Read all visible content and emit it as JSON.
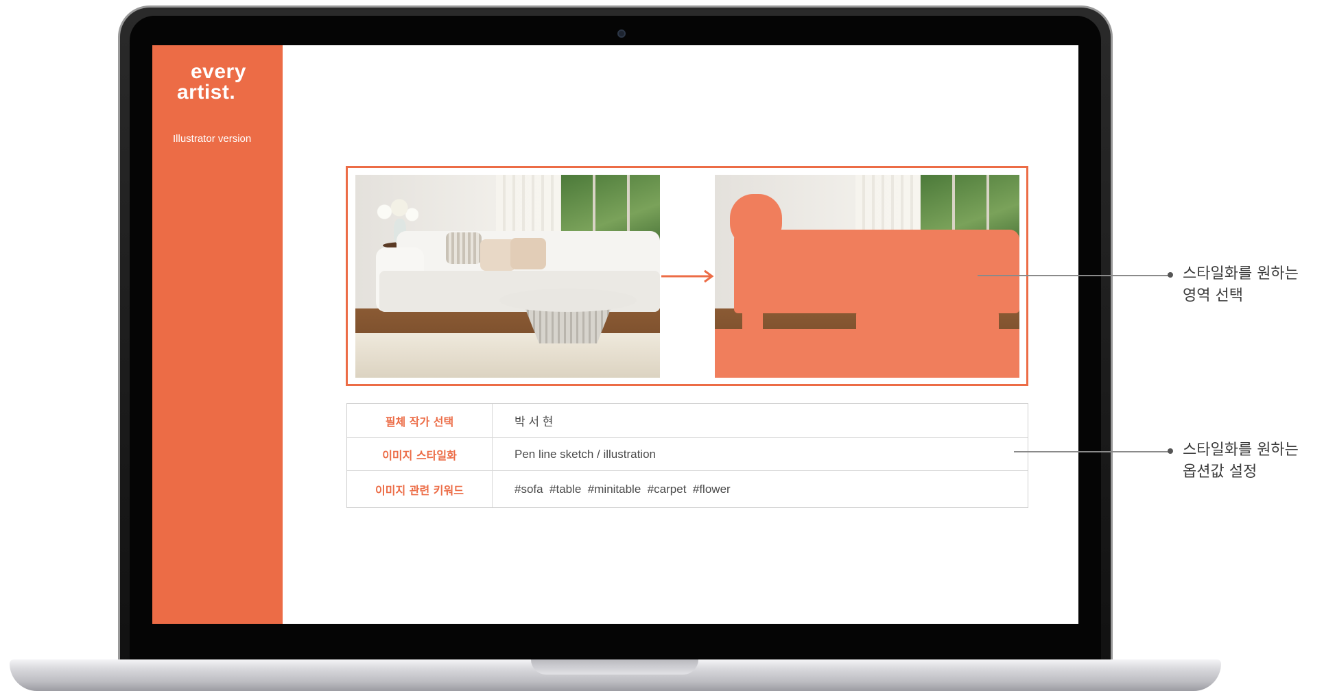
{
  "app": {
    "logo_line1": "every",
    "logo_line2": "artist.",
    "version_label": "Illustrator version"
  },
  "options": {
    "rows": [
      {
        "label": "필체 작가 선택",
        "value": "박 서 현"
      },
      {
        "label": "이미지 스타일화",
        "value": "Pen line sketch / illustration"
      },
      {
        "label": "이미지 관련 키워드",
        "value": "#sofa  #table  #minitable  #carpet  #flower"
      }
    ]
  },
  "callouts": {
    "area_select": {
      "line1": "스타일화를 원하는",
      "line2": "영역 선택"
    },
    "option_set": {
      "line1": "스타일화를 원하는",
      "line2": "옵션값 설정"
    }
  },
  "colors": {
    "accent": "#ec6c46",
    "highlight_overlay": "#f07e5c"
  },
  "icons": {
    "arrow": "arrow-right-icon"
  }
}
